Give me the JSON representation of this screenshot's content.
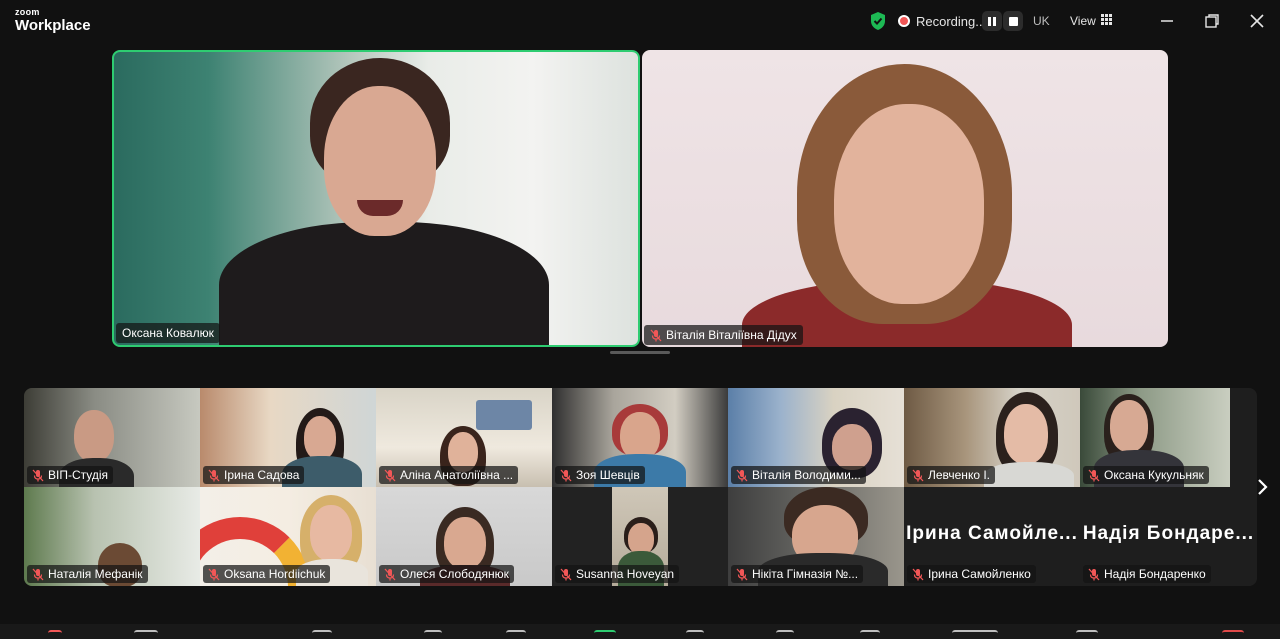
{
  "app": {
    "brand_small": "zoom",
    "brand_large": "Workplace"
  },
  "topbar": {
    "recording_label": "Recording...",
    "language": "UK",
    "view_label": "View"
  },
  "speakers": [
    {
      "name": "Оксана Ковалюк",
      "muted": false,
      "active": true
    },
    {
      "name": "Віталія Віталіївна Дідух",
      "muted": true,
      "active": false
    }
  ],
  "gallery": {
    "row1": [
      {
        "name": "ВІП-Студія",
        "muted": true
      },
      {
        "name": "Ірина Садова",
        "muted": true
      },
      {
        "name": "Аліна Анатоліївна ...",
        "muted": true
      },
      {
        "name": "Зоя Шевців",
        "muted": true
      },
      {
        "name": "Віталія Володими...",
        "muted": true
      },
      {
        "name": "Левченко І.",
        "muted": true
      },
      {
        "name": "Оксана Кукульняк",
        "muted": true
      }
    ],
    "row2": [
      {
        "name": "Наталія Мефанік",
        "muted": true
      },
      {
        "name": "Oksana Hordiichuk",
        "muted": true
      },
      {
        "name": "Олеся Слободянюк",
        "muted": true
      },
      {
        "name": "Susanna Hoveyan",
        "muted": true
      },
      {
        "name": "Нікіта Гімназія №...",
        "muted": true
      },
      {
        "name": "Ірина Самойленко",
        "muted": true,
        "display_name": "Ірина Самойле..."
      },
      {
        "name": "Надія Бондаренко",
        "muted": true,
        "display_name": "Надія Бондаре..."
      }
    ]
  },
  "colors": {
    "active_speaker_border": "#2ecc71",
    "shield": "#1db954",
    "record_dot": "#f25757",
    "muted_icon": "#f25757"
  }
}
